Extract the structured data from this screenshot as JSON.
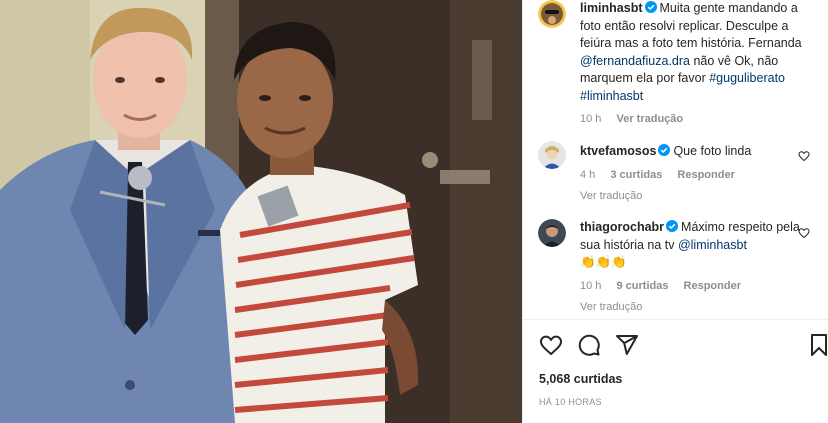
{
  "post": {
    "author": "liminhasbt",
    "caption_text": "Muita gente mandando a foto então resolvi replicar. Desculpe a feiúra mas a foto tem história. Fernanda ",
    "caption_mention": "@fernandafiuza.dra",
    "caption_text2": " não vê Ok, não marquem ela por favor ",
    "caption_tag1": "#guguliberato",
    "caption_tag2": "#liminhasbt",
    "age": "10 h",
    "see_translation": "Ver tradução"
  },
  "comments": [
    {
      "user": "ktvefamosos",
      "text": "Que foto linda",
      "age": "4 h",
      "likes": "3 curtidas",
      "reply": "Responder",
      "see_translation": "Ver tradução"
    },
    {
      "user": "thiagorochabr",
      "text": "Máximo respeito pela sua história na tv ",
      "mention": "@liminhasbt",
      "emoji": "👏👏👏",
      "age": "10 h",
      "likes": "9 curtidas",
      "reply": "Responder",
      "see_translation": "Ver tradução"
    }
  ],
  "footer": {
    "likes": "5,068 curtidas",
    "time": "HÁ 10 HORAS"
  },
  "icons": {
    "like": "heart-icon",
    "comment": "comment-icon",
    "share": "send-icon",
    "save": "bookmark-icon",
    "verified": "verified-badge-icon"
  },
  "colors": {
    "link": "#00376b",
    "verified": "#0095f6",
    "muted": "#8e8e8e"
  }
}
